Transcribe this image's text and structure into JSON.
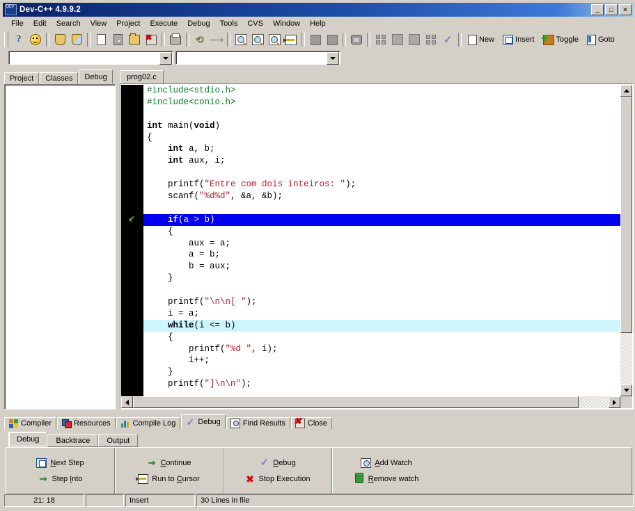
{
  "window": {
    "title": "Dev-C++ 4.9.9.2",
    "icon": "devcpp-logo-icon",
    "minimize": "_",
    "maximize": "□",
    "close": "✕"
  },
  "menubar": {
    "items": [
      {
        "label": "File"
      },
      {
        "label": "Edit"
      },
      {
        "label": "Search"
      },
      {
        "label": "View"
      },
      {
        "label": "Project"
      },
      {
        "label": "Execute"
      },
      {
        "label": "Debug"
      },
      {
        "label": "Tools"
      },
      {
        "label": "CVS"
      },
      {
        "label": "Window"
      },
      {
        "label": "Help"
      }
    ]
  },
  "toolbar": {
    "text_buttons": [
      {
        "label": "New",
        "icon": "new-page-icon"
      },
      {
        "label": "Insert",
        "icon": "insert-icon"
      },
      {
        "label": "Toggle",
        "icon": "toggle-icon"
      },
      {
        "label": "Goto",
        "icon": "goto-icon"
      }
    ]
  },
  "combos": {
    "left_value": "",
    "right_value": ""
  },
  "left_panel": {
    "tabs": [
      {
        "label": "Project",
        "active": false
      },
      {
        "label": "Classes",
        "active": false
      },
      {
        "label": "Debug",
        "active": true
      }
    ],
    "content": ""
  },
  "editor": {
    "tabs": [
      {
        "label": "prog02.c",
        "active": true
      }
    ],
    "lines": [
      {
        "n": 1,
        "kind": "normal",
        "mark": "none",
        "segments": [
          {
            "t": "#include<stdio.h>",
            "c": "pp"
          }
        ]
      },
      {
        "n": 2,
        "kind": "normal",
        "mark": "none",
        "segments": [
          {
            "t": "#include<conio.h>",
            "c": "pp"
          }
        ]
      },
      {
        "n": 3,
        "kind": "normal",
        "mark": "none",
        "segments": [
          {
            "t": "",
            "c": "pl"
          }
        ]
      },
      {
        "n": 4,
        "kind": "normal",
        "mark": "none",
        "segments": [
          {
            "t": "int",
            "c": "kw"
          },
          {
            "t": " main(",
            "c": "pl"
          },
          {
            "t": "void",
            "c": "kw"
          },
          {
            "t": ")",
            "c": "pl"
          }
        ]
      },
      {
        "n": 5,
        "kind": "normal",
        "mark": "none",
        "segments": [
          {
            "t": "{",
            "c": "pl"
          }
        ]
      },
      {
        "n": 6,
        "kind": "normal",
        "mark": "none",
        "segments": [
          {
            "t": "    ",
            "c": "pl"
          },
          {
            "t": "int",
            "c": "kw"
          },
          {
            "t": " a, b;",
            "c": "pl"
          }
        ]
      },
      {
        "n": 7,
        "kind": "normal",
        "mark": "none",
        "segments": [
          {
            "t": "    ",
            "c": "pl"
          },
          {
            "t": "int",
            "c": "kw"
          },
          {
            "t": " aux, i;",
            "c": "pl"
          }
        ]
      },
      {
        "n": 8,
        "kind": "normal",
        "mark": "none",
        "segments": [
          {
            "t": "",
            "c": "pl"
          }
        ]
      },
      {
        "n": 9,
        "kind": "normal",
        "mark": "none",
        "segments": [
          {
            "t": "    printf(",
            "c": "pl"
          },
          {
            "t": "\"Entre com dois inteiros: \"",
            "c": "str"
          },
          {
            "t": ");",
            "c": "pl"
          }
        ]
      },
      {
        "n": 10,
        "kind": "normal",
        "mark": "none",
        "segments": [
          {
            "t": "    scanf(",
            "c": "pl"
          },
          {
            "t": "\"%d%d\"",
            "c": "str"
          },
          {
            "t": ", &a, &b);",
            "c": "pl"
          }
        ]
      },
      {
        "n": 11,
        "kind": "normal",
        "mark": "none",
        "segments": [
          {
            "t": "",
            "c": "pl"
          }
        ]
      },
      {
        "n": 12,
        "kind": "current",
        "mark": "check",
        "segments": [
          {
            "t": "    ",
            "c": "pl"
          },
          {
            "t": "if",
            "c": "kw"
          },
          {
            "t": "(a > b)",
            "c": "pl"
          }
        ]
      },
      {
        "n": 13,
        "kind": "normal",
        "mark": "none",
        "segments": [
          {
            "t": "    {",
            "c": "pl"
          }
        ]
      },
      {
        "n": 14,
        "kind": "normal",
        "mark": "none",
        "segments": [
          {
            "t": "        aux = a;",
            "c": "pl"
          }
        ]
      },
      {
        "n": 15,
        "kind": "normal",
        "mark": "none",
        "segments": [
          {
            "t": "        a = b;",
            "c": "pl"
          }
        ]
      },
      {
        "n": 16,
        "kind": "normal",
        "mark": "none",
        "segments": [
          {
            "t": "        b = aux;",
            "c": "pl"
          }
        ]
      },
      {
        "n": 17,
        "kind": "normal",
        "mark": "none",
        "segments": [
          {
            "t": "    }",
            "c": "pl"
          }
        ]
      },
      {
        "n": 18,
        "kind": "normal",
        "mark": "none",
        "segments": [
          {
            "t": "",
            "c": "pl"
          }
        ]
      },
      {
        "n": 19,
        "kind": "normal",
        "mark": "none",
        "segments": [
          {
            "t": "    printf(",
            "c": "pl"
          },
          {
            "t": "\"\\n\\n[ \"",
            "c": "str"
          },
          {
            "t": ");",
            "c": "pl"
          }
        ]
      },
      {
        "n": 20,
        "kind": "normal",
        "mark": "none",
        "segments": [
          {
            "t": "    i = a;",
            "c": "pl"
          }
        ]
      },
      {
        "n": 21,
        "kind": "breakpoint",
        "mark": "none",
        "segments": [
          {
            "t": "    ",
            "c": "pl"
          },
          {
            "t": "while",
            "c": "kw"
          },
          {
            "t": "(i <= b)",
            "c": "pl"
          }
        ]
      },
      {
        "n": 22,
        "kind": "normal",
        "mark": "none",
        "segments": [
          {
            "t": "    {",
            "c": "pl"
          }
        ]
      },
      {
        "n": 23,
        "kind": "normal",
        "mark": "none",
        "segments": [
          {
            "t": "        printf(",
            "c": "pl"
          },
          {
            "t": "\"%d \"",
            "c": "str"
          },
          {
            "t": ", i);",
            "c": "pl"
          }
        ]
      },
      {
        "n": 24,
        "kind": "normal",
        "mark": "none",
        "segments": [
          {
            "t": "        i++;",
            "c": "pl"
          }
        ]
      },
      {
        "n": 25,
        "kind": "normal",
        "mark": "none",
        "segments": [
          {
            "t": "    }",
            "c": "pl"
          }
        ]
      },
      {
        "n": 26,
        "kind": "normal",
        "mark": "none",
        "segments": [
          {
            "t": "    printf(",
            "c": "pl"
          },
          {
            "t": "\"]\\n\\n\"",
            "c": "str"
          },
          {
            "t": ");",
            "c": "pl"
          }
        ]
      }
    ]
  },
  "bottom_panel": {
    "tabs": [
      {
        "label": "Compiler",
        "icon": "compiler-icon",
        "active": false
      },
      {
        "label": "Resources",
        "icon": "resources-icon",
        "active": false
      },
      {
        "label": "Compile Log",
        "icon": "compile-log-icon",
        "active": false
      },
      {
        "label": "Debug",
        "icon": "debug-check-icon",
        "active": true
      },
      {
        "label": "Find Results",
        "icon": "find-results-icon",
        "active": false
      },
      {
        "label": "Close",
        "icon": "close-red-icon",
        "active": false
      }
    ],
    "subtabs": [
      {
        "label": "Debug",
        "active": true
      },
      {
        "label": "Backtrace",
        "active": false
      },
      {
        "label": "Output",
        "active": false
      }
    ],
    "groups": [
      {
        "buttons": [
          {
            "label": "Next Step",
            "accel": "N",
            "icon": "next-step-icon"
          },
          {
            "label": "Step Into",
            "accel": "I",
            "icon": "step-into-icon"
          }
        ]
      },
      {
        "buttons": [
          {
            "label": "Continue",
            "accel": "C",
            "icon": "continue-icon"
          },
          {
            "label": "Run to Cursor",
            "accel": "C",
            "icon": "run-to-cursor-icon"
          }
        ]
      },
      {
        "buttons": [
          {
            "label": "Debug",
            "accel": "D",
            "icon": "debug-check-icon"
          },
          {
            "label": "Stop Execution",
            "accel": "",
            "icon": "stop-execution-icon"
          }
        ]
      },
      {
        "buttons": [
          {
            "label": "Add Watch",
            "accel": "A",
            "icon": "add-watch-icon"
          },
          {
            "label": "Remove watch",
            "accel": "R",
            "icon": "remove-watch-icon"
          }
        ]
      }
    ]
  },
  "statusbar": {
    "position": "21: 18",
    "modified": "",
    "insert_mode": "Insert",
    "line_count": "30 Lines in file"
  }
}
